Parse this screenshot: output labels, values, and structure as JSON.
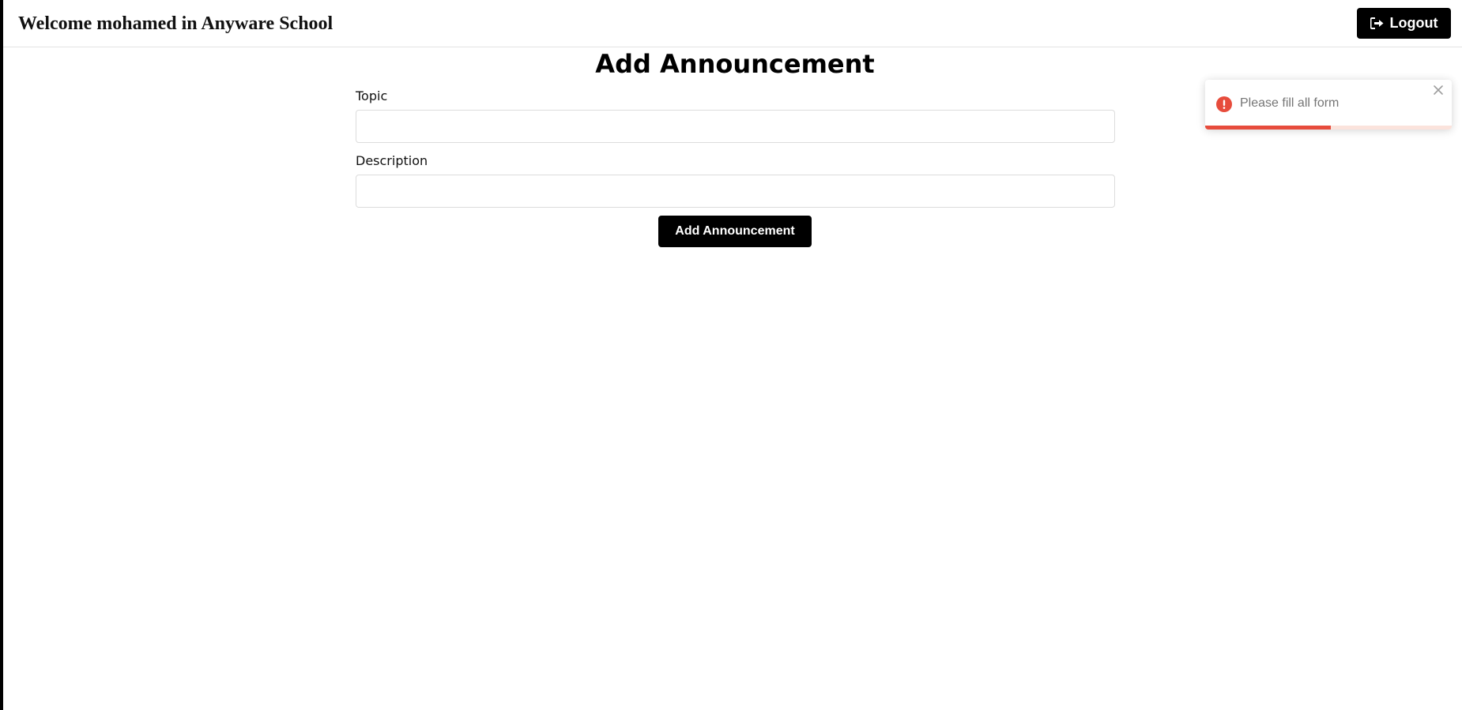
{
  "header": {
    "welcome_text": "Welcome mohamed in Anyware School",
    "logout_label": "Logout",
    "logout_icon": "sign-out-icon"
  },
  "form": {
    "title": "Add Announcement",
    "topic_label": "Topic",
    "topic_value": "",
    "description_label": "Description",
    "description_value": "",
    "submit_label": "Add Announcement"
  },
  "toast": {
    "type": "error",
    "icon": "exclamation-circle-icon",
    "message": "Please fill all form",
    "progress": 0.51,
    "accent_color": "#e74c3c"
  },
  "colors": {
    "primary_button": "#000000",
    "error": "#e74c3c"
  }
}
